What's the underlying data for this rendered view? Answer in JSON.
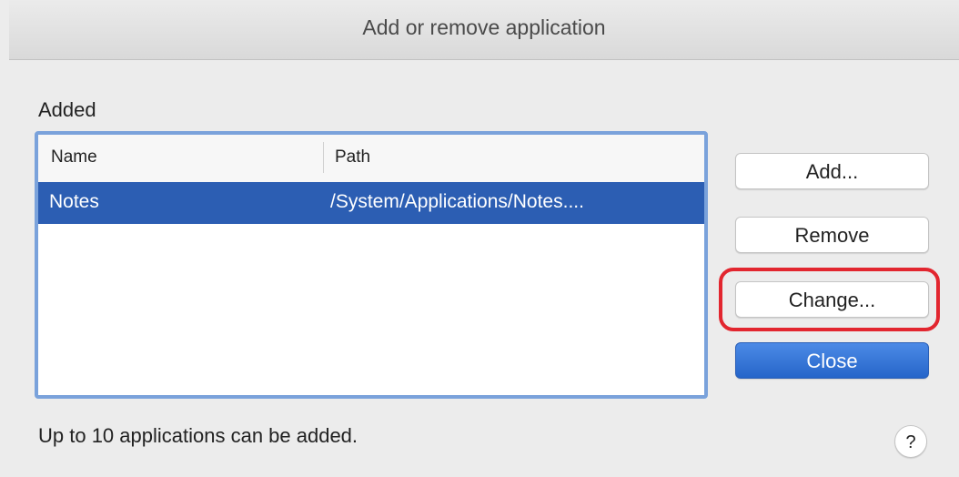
{
  "window": {
    "title": "Add or remove application"
  },
  "list": {
    "label": "Added",
    "columns": {
      "name": "Name",
      "path": "Path"
    },
    "rows": [
      {
        "name": "Notes",
        "path": "/System/Applications/Notes....",
        "selected": true
      }
    ]
  },
  "buttons": {
    "add": "Add...",
    "remove": "Remove",
    "change": "Change...",
    "close": "Close"
  },
  "footer": {
    "note": "Up to 10 applications can be added.",
    "help": "?"
  },
  "colors": {
    "selection": "#2c5eb3",
    "highlight_ring": "#e2262f",
    "default_button": "#2565c9"
  }
}
